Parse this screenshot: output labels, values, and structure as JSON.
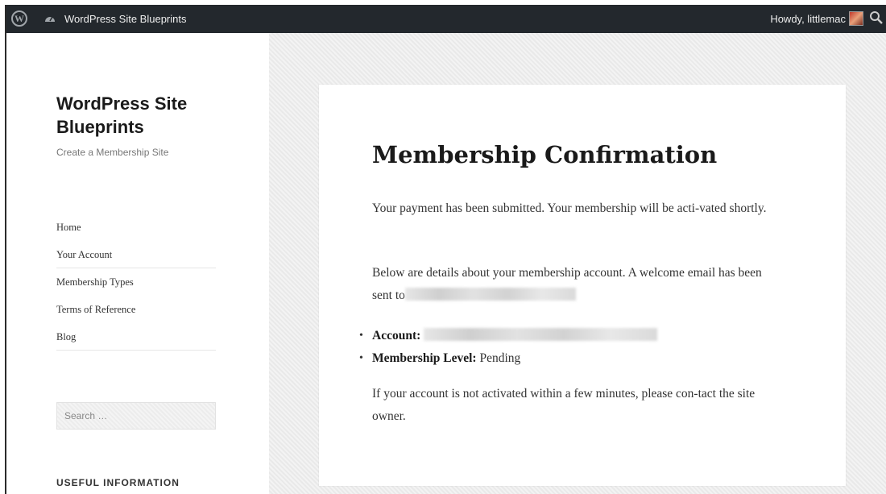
{
  "admin_bar": {
    "site_name": "WordPress Site Blueprints",
    "howdy": "Howdy, littlemac"
  },
  "sidebar": {
    "site_title": "WordPress Site Blueprints",
    "site_description": "Create a Membership Site",
    "nav_items": [
      {
        "label": "Home"
      },
      {
        "label": "Your Account"
      },
      {
        "label": "Membership Types"
      },
      {
        "label": "Terms of Reference"
      },
      {
        "label": "Blog"
      }
    ],
    "search_placeholder": "Search …",
    "widget_title": "USEFUL INFORMATION"
  },
  "content": {
    "title": "Membership Confirmation",
    "paragraph1": "Your payment has been submitted. Your membership will be acti-vated shortly.",
    "paragraph2": "Below are details about your membership account. A welcome email has been sent to",
    "account_label": "Account:",
    "level_label": "Membership Level:",
    "level_value": "Pending",
    "paragraph3": "If your account is not activated within a few minutes, please con-tact the site owner."
  },
  "colors": {
    "admin_bar": "#23282d",
    "background_pattern": "#e9e9e9",
    "card": "#ffffff"
  }
}
